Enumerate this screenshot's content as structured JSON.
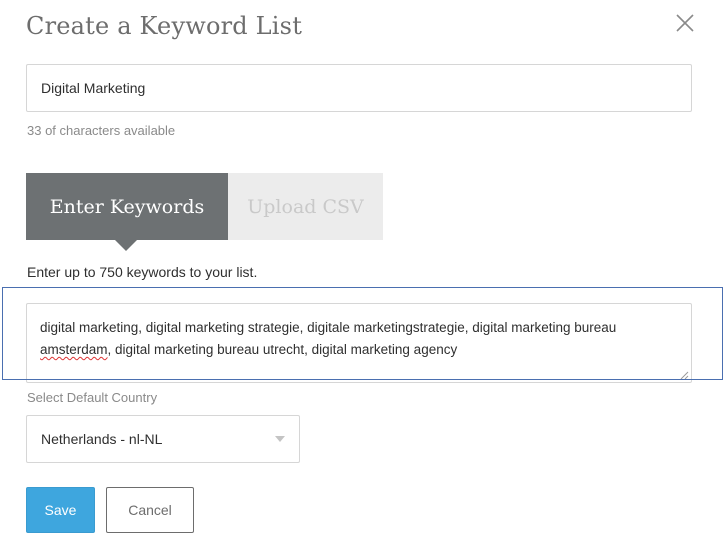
{
  "dialog": {
    "title": "Create a Keyword List",
    "close_icon": "close-icon"
  },
  "list_name": {
    "value": "Digital Marketing",
    "chars_available": "33 of characters available"
  },
  "tabs": [
    {
      "label": "Enter Keywords",
      "active": true
    },
    {
      "label": "Upload CSV",
      "active": false
    }
  ],
  "keywords": {
    "instruction": "Enter up to 750 keywords to your list.",
    "text_before": "digital marketing, digital marketing strategie, digitale marketingstrategie, digital marketing bureau ",
    "misspelled_word": "amsterdam",
    "text_after": ", digital marketing bureau utrecht, digital marketing agency"
  },
  "country": {
    "label": "Select Default Country",
    "selected": "Netherlands - nl-NL"
  },
  "buttons": {
    "save": "Save",
    "cancel": "Cancel"
  },
  "colors": {
    "active_tab": "#6d7173",
    "inactive_tab": "#ececec",
    "save_button": "#3ea6de",
    "highlight_outline": "#4a6fb0"
  }
}
